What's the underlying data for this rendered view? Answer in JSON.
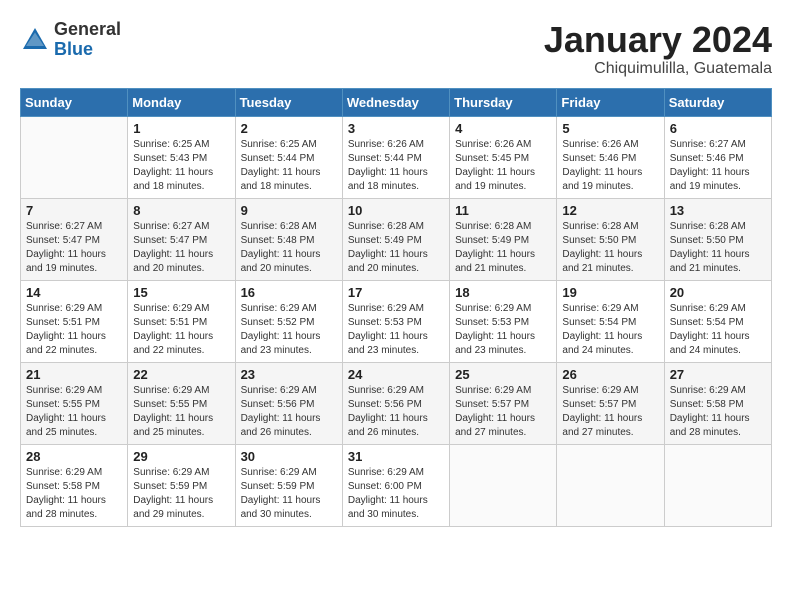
{
  "logo": {
    "general": "General",
    "blue": "Blue"
  },
  "title": "January 2024",
  "subtitle": "Chiquimulilla, Guatemala",
  "days_of_week": [
    "Sunday",
    "Monday",
    "Tuesday",
    "Wednesday",
    "Thursday",
    "Friday",
    "Saturday"
  ],
  "weeks": [
    [
      {
        "day": "",
        "info": ""
      },
      {
        "day": "1",
        "info": "Sunrise: 6:25 AM\nSunset: 5:43 PM\nDaylight: 11 hours\nand 18 minutes."
      },
      {
        "day": "2",
        "info": "Sunrise: 6:25 AM\nSunset: 5:44 PM\nDaylight: 11 hours\nand 18 minutes."
      },
      {
        "day": "3",
        "info": "Sunrise: 6:26 AM\nSunset: 5:44 PM\nDaylight: 11 hours\nand 18 minutes."
      },
      {
        "day": "4",
        "info": "Sunrise: 6:26 AM\nSunset: 5:45 PM\nDaylight: 11 hours\nand 19 minutes."
      },
      {
        "day": "5",
        "info": "Sunrise: 6:26 AM\nSunset: 5:46 PM\nDaylight: 11 hours\nand 19 minutes."
      },
      {
        "day": "6",
        "info": "Sunrise: 6:27 AM\nSunset: 5:46 PM\nDaylight: 11 hours\nand 19 minutes."
      }
    ],
    [
      {
        "day": "7",
        "info": "Sunrise: 6:27 AM\nSunset: 5:47 PM\nDaylight: 11 hours\nand 19 minutes."
      },
      {
        "day": "8",
        "info": "Sunrise: 6:27 AM\nSunset: 5:47 PM\nDaylight: 11 hours\nand 20 minutes."
      },
      {
        "day": "9",
        "info": "Sunrise: 6:28 AM\nSunset: 5:48 PM\nDaylight: 11 hours\nand 20 minutes."
      },
      {
        "day": "10",
        "info": "Sunrise: 6:28 AM\nSunset: 5:49 PM\nDaylight: 11 hours\nand 20 minutes."
      },
      {
        "day": "11",
        "info": "Sunrise: 6:28 AM\nSunset: 5:49 PM\nDaylight: 11 hours\nand 21 minutes."
      },
      {
        "day": "12",
        "info": "Sunrise: 6:28 AM\nSunset: 5:50 PM\nDaylight: 11 hours\nand 21 minutes."
      },
      {
        "day": "13",
        "info": "Sunrise: 6:28 AM\nSunset: 5:50 PM\nDaylight: 11 hours\nand 21 minutes."
      }
    ],
    [
      {
        "day": "14",
        "info": "Sunrise: 6:29 AM\nSunset: 5:51 PM\nDaylight: 11 hours\nand 22 minutes."
      },
      {
        "day": "15",
        "info": "Sunrise: 6:29 AM\nSunset: 5:51 PM\nDaylight: 11 hours\nand 22 minutes."
      },
      {
        "day": "16",
        "info": "Sunrise: 6:29 AM\nSunset: 5:52 PM\nDaylight: 11 hours\nand 23 minutes."
      },
      {
        "day": "17",
        "info": "Sunrise: 6:29 AM\nSunset: 5:53 PM\nDaylight: 11 hours\nand 23 minutes."
      },
      {
        "day": "18",
        "info": "Sunrise: 6:29 AM\nSunset: 5:53 PM\nDaylight: 11 hours\nand 23 minutes."
      },
      {
        "day": "19",
        "info": "Sunrise: 6:29 AM\nSunset: 5:54 PM\nDaylight: 11 hours\nand 24 minutes."
      },
      {
        "day": "20",
        "info": "Sunrise: 6:29 AM\nSunset: 5:54 PM\nDaylight: 11 hours\nand 24 minutes."
      }
    ],
    [
      {
        "day": "21",
        "info": "Sunrise: 6:29 AM\nSunset: 5:55 PM\nDaylight: 11 hours\nand 25 minutes."
      },
      {
        "day": "22",
        "info": "Sunrise: 6:29 AM\nSunset: 5:55 PM\nDaylight: 11 hours\nand 25 minutes."
      },
      {
        "day": "23",
        "info": "Sunrise: 6:29 AM\nSunset: 5:56 PM\nDaylight: 11 hours\nand 26 minutes."
      },
      {
        "day": "24",
        "info": "Sunrise: 6:29 AM\nSunset: 5:56 PM\nDaylight: 11 hours\nand 26 minutes."
      },
      {
        "day": "25",
        "info": "Sunrise: 6:29 AM\nSunset: 5:57 PM\nDaylight: 11 hours\nand 27 minutes."
      },
      {
        "day": "26",
        "info": "Sunrise: 6:29 AM\nSunset: 5:57 PM\nDaylight: 11 hours\nand 27 minutes."
      },
      {
        "day": "27",
        "info": "Sunrise: 6:29 AM\nSunset: 5:58 PM\nDaylight: 11 hours\nand 28 minutes."
      }
    ],
    [
      {
        "day": "28",
        "info": "Sunrise: 6:29 AM\nSunset: 5:58 PM\nDaylight: 11 hours\nand 28 minutes."
      },
      {
        "day": "29",
        "info": "Sunrise: 6:29 AM\nSunset: 5:59 PM\nDaylight: 11 hours\nand 29 minutes."
      },
      {
        "day": "30",
        "info": "Sunrise: 6:29 AM\nSunset: 5:59 PM\nDaylight: 11 hours\nand 30 minutes."
      },
      {
        "day": "31",
        "info": "Sunrise: 6:29 AM\nSunset: 6:00 PM\nDaylight: 11 hours\nand 30 minutes."
      },
      {
        "day": "",
        "info": ""
      },
      {
        "day": "",
        "info": ""
      },
      {
        "day": "",
        "info": ""
      }
    ]
  ]
}
